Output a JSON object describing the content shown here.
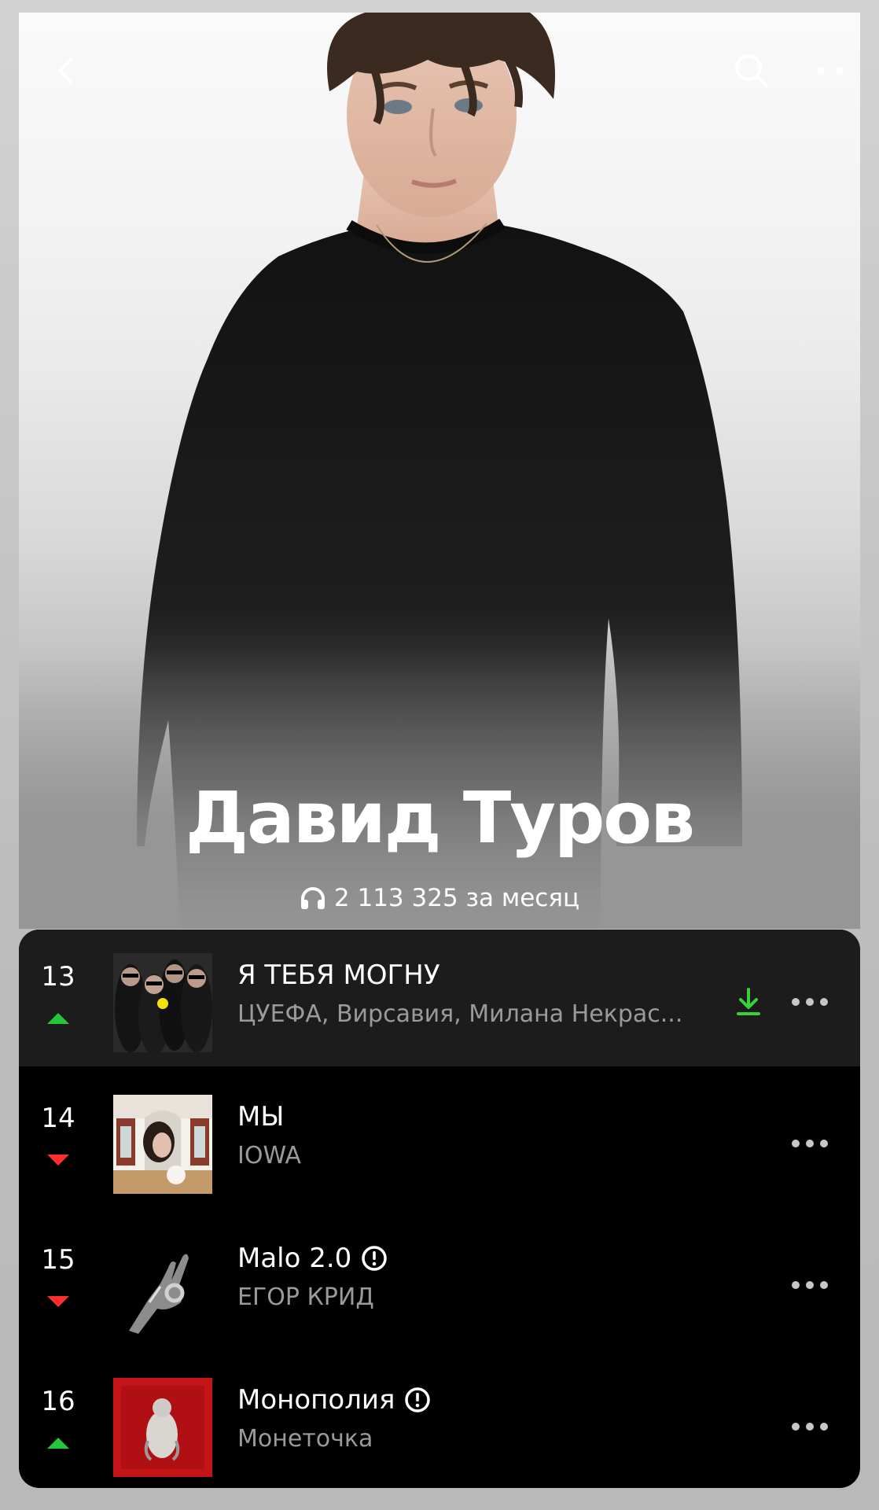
{
  "header": {
    "back_icon": "chevron-left-icon",
    "search_icon": "search-icon",
    "more_icon": "more-horizontal-icon"
  },
  "artist": {
    "name": "Давид Туров",
    "listeners_icon": "headphones-icon",
    "listeners_text": "2 113 325 за месяц"
  },
  "colors": {
    "trend_up": "#22c73a",
    "trend_down": "#ff2d2d",
    "download": "#3ccf3c",
    "active_row": "#1c1c1c",
    "secondary_text": "#9a9a9a"
  },
  "tracks": [
    {
      "rank": "13",
      "trend": "up",
      "title": "Я ТЕБЯ МОГНУ",
      "artists": "ЦУЕФА, Вирсавия, Милана Некрас...",
      "explicit": false,
      "downloaded": true,
      "active": true
    },
    {
      "rank": "14",
      "trend": "down",
      "title": "МЫ",
      "artists": "IOWA",
      "explicit": false,
      "downloaded": false,
      "active": false
    },
    {
      "rank": "15",
      "trend": "down",
      "title": "Malo 2.0",
      "artists": "ЕГОР КРИД",
      "explicit": true,
      "downloaded": false,
      "active": false
    },
    {
      "rank": "16",
      "trend": "up",
      "title": "Монополия",
      "artists": "Монеточка",
      "explicit": true,
      "downloaded": false,
      "active": false
    }
  ]
}
